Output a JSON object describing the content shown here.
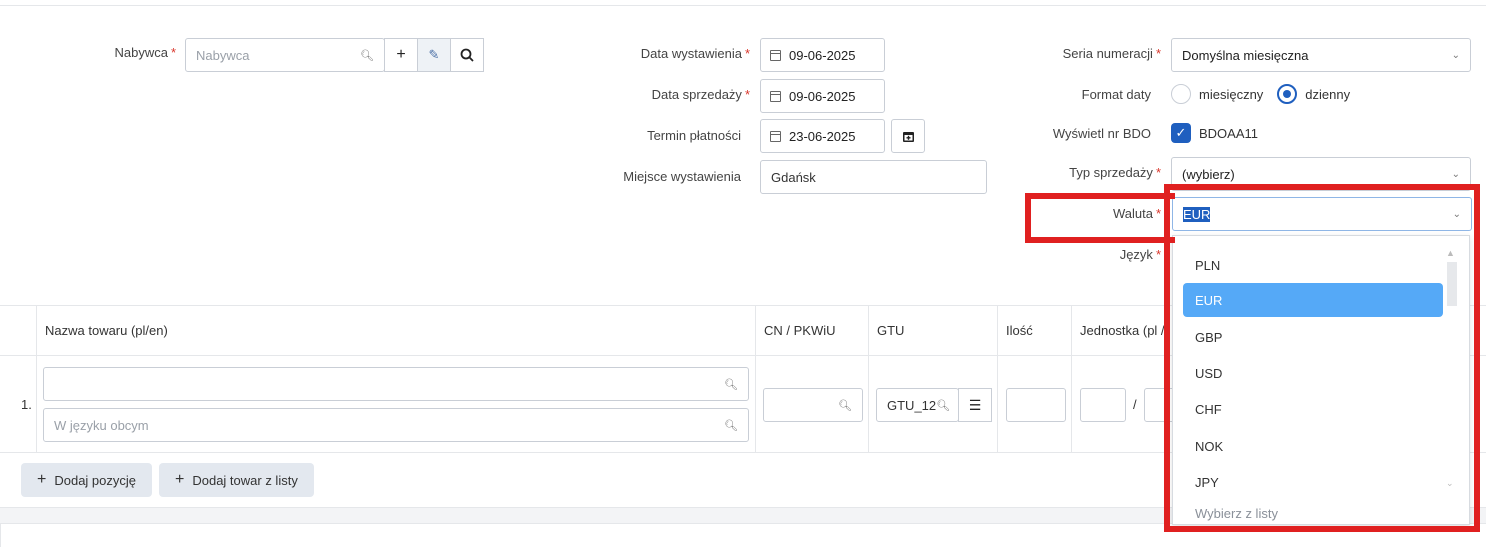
{
  "buyer": {
    "label": "Nabywca",
    "placeholder": "Nabywca"
  },
  "dates": {
    "issue_label": "Data wystawienia",
    "issue_value": "09-06-2025",
    "sale_label": "Data sprzedaży",
    "sale_value": "09-06-2025",
    "due_label": "Termin płatności",
    "due_value": "23-06-2025",
    "place_label": "Miejsce wystawienia",
    "place_value": "Gdańsk"
  },
  "settings": {
    "series_label": "Seria numeracji",
    "series_value": "Domyślna miesięczna",
    "date_format_label": "Format daty",
    "monthly_label": "miesięczny",
    "daily_label": "dzienny",
    "bdo_label": "Wyświetl nr BDO",
    "bdo_value": "BDOAA11",
    "sale_type_label": "Typ sprzedaży",
    "sale_type_value": "(wybierz)",
    "currency_label": "Waluta",
    "currency_value": "EUR",
    "language_label": "Język"
  },
  "currency_options": [
    "PLN",
    "EUR",
    "GBP",
    "USD",
    "CHF",
    "NOK",
    "JPY"
  ],
  "currency_footer": "Wybierz z listy",
  "table": {
    "headers": {
      "name": "Nazwa towaru (pl/en)",
      "cn": "CN / PKWiU",
      "gtu": "GTU",
      "qty": "Ilość",
      "unit": "Jednostka (pl /"
    },
    "row_number": "1.",
    "foreign_placeholder": "W języku obcym",
    "gtu_value": "GTU_12",
    "unit_sep": "/"
  },
  "buttons": {
    "add_position": "Dodaj pozycję",
    "add_from_list": "Dodaj towar z listy"
  },
  "colors": {
    "accent": "#1f5fbf",
    "selected_option": "#55a9f7",
    "highlight_box": "#e02020"
  }
}
